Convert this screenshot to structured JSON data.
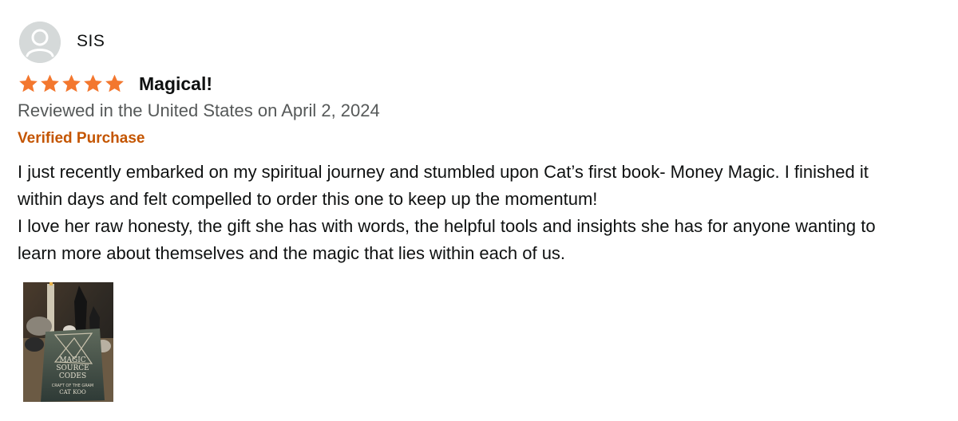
{
  "reviewer": {
    "name": "SIS",
    "avatar_icon": "default-user-avatar-icon"
  },
  "rating": {
    "value": 5,
    "max": 5,
    "star_color": "#f3772e"
  },
  "review": {
    "title": "Magical!",
    "date_line": "Reviewed in the United States on April 2, 2024",
    "verified_label": "Verified Purchase",
    "verified_color": "#c45500",
    "paragraphs": [
      "I just recently embarked on my spiritual journey and stumbled upon Cat’s first book- Money Magic. I finished it within days and felt compelled to order this one to keep up the momentum!",
      "I love her raw honesty, the gift she has with words, the helpful tools and insights she has for anyone wanting to learn more about themselves and the magic that lies within each of us."
    ],
    "image": {
      "cover_title": "MAGIC SOURCE CODES",
      "cover_subtitle": "CRAFT OF THE GRAM",
      "cover_author": "CAT KOO"
    }
  }
}
